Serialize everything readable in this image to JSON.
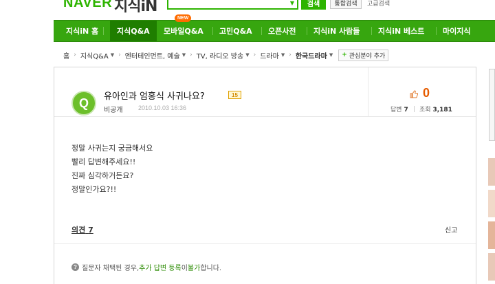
{
  "header": {
    "logo_naver": "NAVER",
    "logo_jisik": "지식iN",
    "search_button": "검색",
    "integrated_search_button": "통합검색",
    "advanced_search_link": "고급검색"
  },
  "nav": {
    "items": [
      {
        "label": "지식iN 홈",
        "active": false
      },
      {
        "label": "지식Q&A",
        "active": true
      },
      {
        "label": "모바일Q&A",
        "active": false
      },
      {
        "label": "고민Q&A",
        "active": false
      },
      {
        "label": "오픈사전",
        "active": false
      },
      {
        "label": "지식iN 사람들",
        "active": false
      },
      {
        "label": "지식iN 베스트",
        "active": false
      },
      {
        "label": "마이지식",
        "active": false
      }
    ],
    "new_badge": "NEW"
  },
  "breadcrumb": {
    "items": [
      "홈",
      "지식Q&A",
      "엔터테인먼트, 예술",
      "TV, 라디오 방송",
      "드라마",
      "한국드라마"
    ],
    "add_interest_button": "관심분야 추가"
  },
  "question": {
    "title": "유아인과 엄홍식 사귀나요?",
    "points": "15",
    "author": "비공개",
    "date": "2010.10.03 16:36",
    "likes": "0",
    "answers_label": "답변",
    "answers_count": "7",
    "views_label": "조회",
    "views_count": "3,181",
    "body_lines": [
      "정말 사귀는지 궁금해서요",
      "빨리 답변해주세요!!",
      "진짜 심각하거든요?",
      "정말인가요?!!"
    ],
    "comments_label": "의견",
    "comments_count": "7",
    "report_label": "신고"
  },
  "notice": {
    "prefix": "질문자 채택된 경우, ",
    "emphasis1": "추가 답변 등록",
    "middle": "이 ",
    "emphasis2": "불가",
    "suffix": "합니다."
  },
  "colors": {
    "naver_green": "#2db400",
    "nav_bg": "#37a60f",
    "nav_active": "#1f7e00",
    "like_count": "#e65c00"
  },
  "icons": {
    "avatar": "question-q-avatar",
    "like": "thumb-up-icon",
    "info": "info-circle-icon",
    "dropdown": "chevron-down-icon"
  }
}
